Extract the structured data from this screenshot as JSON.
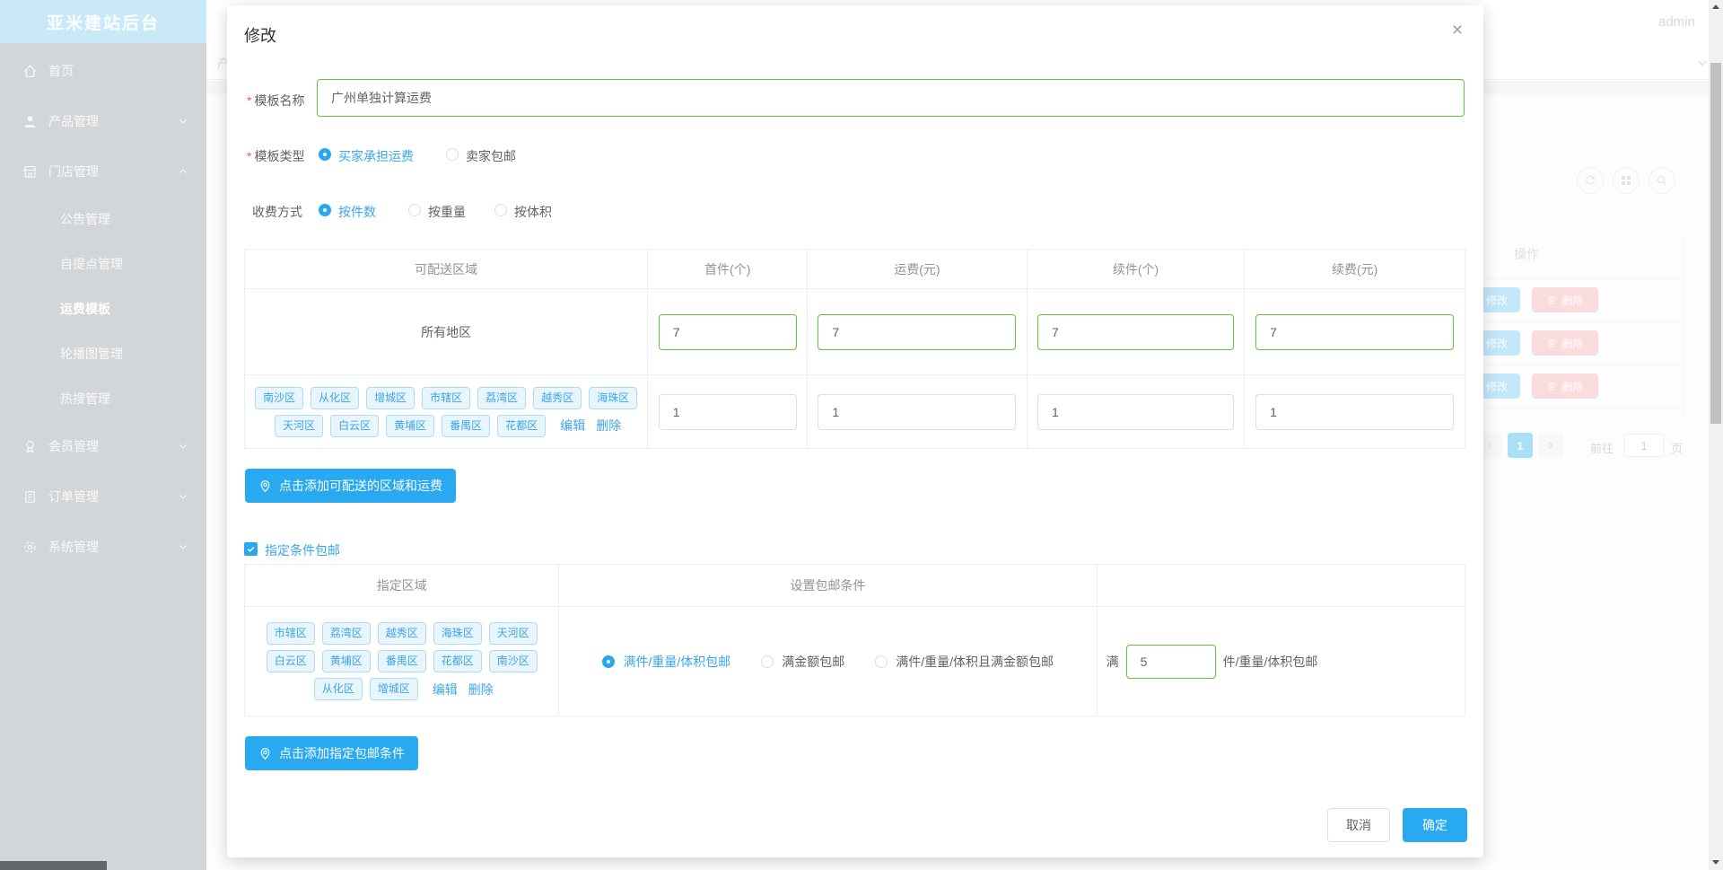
{
  "app": {
    "title": "亚米建站后台",
    "user": "admin"
  },
  "sidebar": {
    "items": [
      {
        "label": "首页"
      },
      {
        "label": "产品管理"
      },
      {
        "label": "门店管理"
      },
      {
        "label": "会员管理"
      },
      {
        "label": "订单管理"
      },
      {
        "label": "系统管理"
      }
    ],
    "submenu": [
      {
        "label": "公告管理"
      },
      {
        "label": "自提点管理"
      },
      {
        "label": "运费模板"
      },
      {
        "label": "轮播图管理"
      },
      {
        "label": "热搜管理"
      }
    ],
    "active_submenu": "运费模板"
  },
  "background": {
    "breadcrumb_partial": "产",
    "ops_header": "操作",
    "edit_label": "修改",
    "delete_label": "删除",
    "pagination": {
      "page": "1",
      "goto_prefix": "前往",
      "goto_value": "1",
      "goto_suffix": "页"
    }
  },
  "modal": {
    "title": "修改",
    "close_icon": "×",
    "required_mark": "*",
    "name_field": {
      "label": "模板名称",
      "value": "广州单独计算运费"
    },
    "type_field": {
      "label": "模板类型",
      "options": [
        "买家承担运费",
        "卖家包邮"
      ],
      "selected": "买家承担运费"
    },
    "charge_field": {
      "label": "收费方式",
      "options": [
        "按件数",
        "按重量",
        "按体积"
      ],
      "selected": "按件数"
    },
    "region_table": {
      "headers": [
        "可配送区域",
        "首件(个)",
        "运费(元)",
        "续件(个)",
        "续费(元)"
      ],
      "all_regions_label": "所有地区",
      "all_regions_values": {
        "first": "7",
        "fee": "7",
        "additional": "7",
        "additional_fee": "7"
      },
      "district_line1": [
        "南沙区",
        "从化区",
        "增城区",
        "市辖区",
        "荔湾区",
        "越秀区",
        "海珠区"
      ],
      "district_line2": [
        "天河区",
        "白云区",
        "黄埔区",
        "番禺区",
        "花都区"
      ],
      "edit_link": "编辑",
      "delete_link": "删除",
      "district_values": {
        "first": "1",
        "fee": "1",
        "additional": "1",
        "additional_fee": "1"
      }
    },
    "add_region_button": "点击添加可配送的区域和运费",
    "free_shipping": {
      "label": "指定条件包邮",
      "checked": true
    },
    "condition_table": {
      "headers": [
        "指定区域",
        "设置包邮条件",
        ""
      ],
      "district_line1": [
        "市辖区",
        "荔湾区",
        "越秀区",
        "海珠区",
        "天河区"
      ],
      "district_line2": [
        "白云区",
        "黄埔区",
        "番禺区",
        "花都区",
        "南沙区"
      ],
      "district_line3": [
        "从化区",
        "增城区"
      ],
      "edit_link": "编辑",
      "delete_link": "删除",
      "conditions": [
        "满件/重量/体积包邮",
        "满金额包邮",
        "满件/重量/体积且满金额包邮"
      ],
      "selected_condition": "满件/重量/体积包邮",
      "threshold": {
        "prefix": "满",
        "value": "5",
        "suffix": "件/重量/体积包邮"
      }
    },
    "add_condition_button": "点击添加指定包邮条件",
    "footer": {
      "cancel": "取消",
      "confirm": "确定"
    }
  },
  "colors": {
    "primary": "#29a9ef",
    "success_border": "#67c23a",
    "link_blue": "#3aa5ea",
    "sidebar_header": "#c9e9f9",
    "danger_dim": "#fadcdd"
  }
}
